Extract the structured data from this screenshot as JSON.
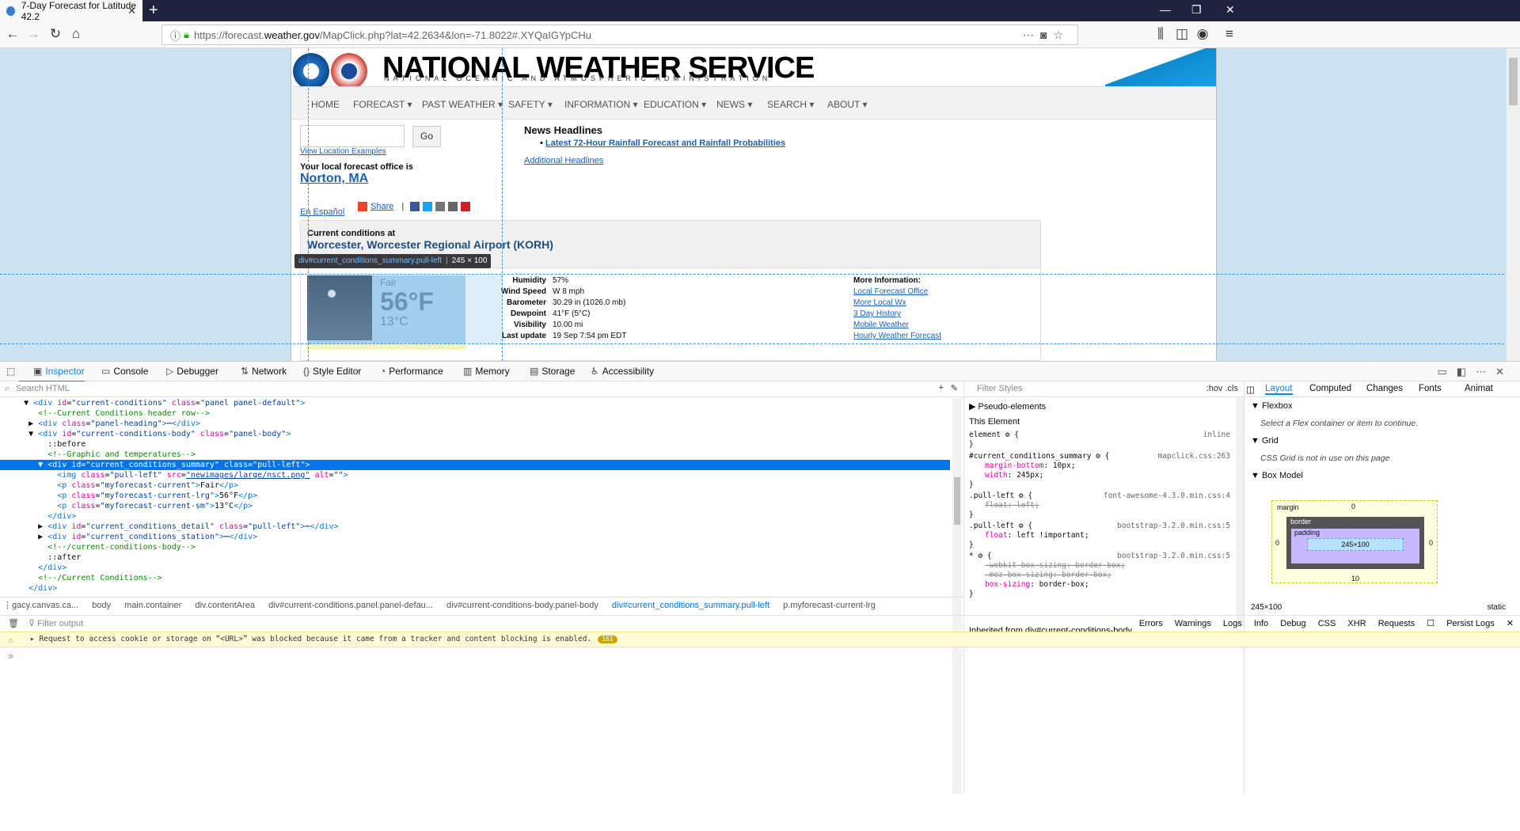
{
  "browser": {
    "tab_title": "7-Day Forecast for Latitude 42.2",
    "url_prefix": "https://forecast.",
    "url_domain": "weather.gov",
    "url_suffix": "/MapClick.php?lat=42.2634&lon=-71.8022#.XYQaIGYpCHu"
  },
  "site": {
    "title": "NATIONAL WEATHER SERVICE",
    "subtitle": "NATIONAL OCEANIC AND ATMOSPHERIC ADMINISTRATION",
    "menu": [
      "HOME",
      "FORECAST ▾",
      "PAST WEATHER ▾",
      "SAFETY ▾",
      "INFORMATION ▾",
      "EDUCATION ▾",
      "NEWS ▾",
      "SEARCH ▾",
      "ABOUT ▾"
    ],
    "go_label": "Go",
    "location_examples": "View Location Examples",
    "local_office_text": "Your local forecast office is",
    "local_office": "Norton, MA",
    "espanol": "En Español",
    "share": "Share",
    "news_heading": "News Headlines",
    "news_item": "Latest 72-Hour Rainfall Forecast and Rainfall Probabilities",
    "additional": "Additional Headlines"
  },
  "conditions": {
    "at_label": "Current conditions at",
    "station": "Worcester, Worcester Regional Airport (KORH)",
    "summary": "Fair",
    "temp_f": "56°F",
    "temp_c": "13°C",
    "details": [
      {
        "label": "Humidity",
        "value": "57%"
      },
      {
        "label": "Wind Speed",
        "value": "W 8 mph"
      },
      {
        "label": "Barometer",
        "value": "30.29 in (1026.0 mb)"
      },
      {
        "label": "Dewpoint",
        "value": "41°F (5°C)"
      },
      {
        "label": "Visibility",
        "value": "10.00 mi"
      },
      {
        "label": "Last update",
        "value": "19 Sep 7:54 pm EDT"
      }
    ],
    "more_info_label": "More Information:",
    "more_links": [
      "Local Forecast Office",
      "More Local Wx",
      "3 Day History",
      "Mobile Weather",
      "Hourly Weather Forecast"
    ]
  },
  "inspector": {
    "highlight_tag": "div#current_conditions_summary.pull-left",
    "highlight_size": "245 × 100"
  },
  "devtools": {
    "tabs": [
      "Inspector",
      "Console",
      "Debugger",
      "Network",
      "Style Editor",
      "Performance",
      "Memory",
      "Storage",
      "Accessibility"
    ],
    "search_placeholder": "Search HTML",
    "filter_styles": "Filter Styles",
    "filter_right": ":hov  .cls",
    "breadcrumbs": [
      "⋮gacy.canvas.ca...",
      "body",
      "main.container",
      "div.contentArea",
      "div#current-conditions.panel.panel-defau...",
      "div#current-conditions-body.panel-body",
      "div#current_conditions_summary.pull-left",
      "p.myforecast-current-lrg"
    ],
    "pseudo": "Pseudo-elements",
    "this_element": "This Element",
    "inherited": "Inherited from div#current-conditions-body",
    "layout_tabs": [
      "Layout",
      "Computed",
      "Changes",
      "Fonts",
      "Animat"
    ],
    "flexbox": "Flexbox",
    "flexbox_note": "Select a Flex container or item to continue.",
    "grid": "Grid",
    "grid_note": "CSS Grid is not in use on this page",
    "box_model": "Box Model",
    "bm_margin": "margin",
    "bm_border": "border",
    "bm_padding": "padding",
    "bm_content": "245×100",
    "bm_size": "245×100",
    "bm_position": "static",
    "bm_zero": "0",
    "bm_ten": "10",
    "filter_output": "Filter output",
    "console_filters": [
      "Errors",
      "Warnings",
      "Logs",
      "Info",
      "Debug",
      "CSS",
      "XHR",
      "Requests",
      "Persist Logs"
    ],
    "console_msg": "Request to access cookie or storage on “<URL>” was blocked because it came from a tracker and content blocking is enabled.",
    "console_count": "161",
    "console_prompt": "»"
  }
}
